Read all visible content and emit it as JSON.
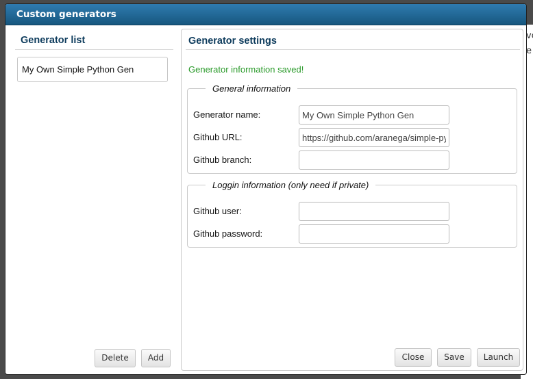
{
  "dialog": {
    "title": "Custom generators"
  },
  "generator_list": {
    "heading": "Generator list",
    "items": [
      {
        "label": "My Own Simple Python Gen"
      }
    ],
    "delete_label": "Delete",
    "add_label": "Add"
  },
  "settings": {
    "heading": "Generator settings",
    "status_message": "Generator information saved!",
    "general": {
      "legend": "General information",
      "name_label": "Generator name:",
      "name_value": "My Own Simple Python Gen",
      "url_label": "Github URL:",
      "url_value": "https://github.com/aranega/simple-py",
      "branch_label": "Github branch:",
      "branch_value": ""
    },
    "login": {
      "legend": "Loggin information (only need if private)",
      "user_label": "Github user:",
      "user_value": "",
      "password_label": "Github password:",
      "password_value": ""
    },
    "close_label": "Close",
    "save_label": "Save",
    "launch_label": "Launch"
  },
  "background": {
    "fragment_1": "vo",
    "fragment_2": "e"
  },
  "colors": {
    "titlebar": "#1f6a99",
    "heading": "#0d3b5c",
    "success": "#2a9a2a"
  }
}
